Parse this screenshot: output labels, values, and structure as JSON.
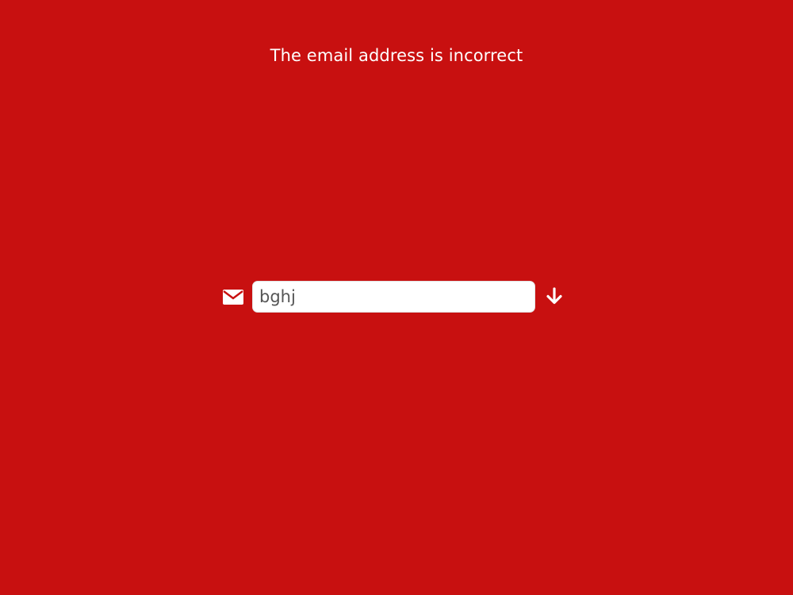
{
  "error": {
    "message": "The email address is incorrect"
  },
  "form": {
    "email_value": "bghj",
    "email_icon": "envelope-icon",
    "submit_icon": "arrow-down-icon"
  },
  "colors": {
    "background": "#c81010",
    "text": "#ffffff",
    "input_background": "#ffffff",
    "input_text": "#555555"
  }
}
